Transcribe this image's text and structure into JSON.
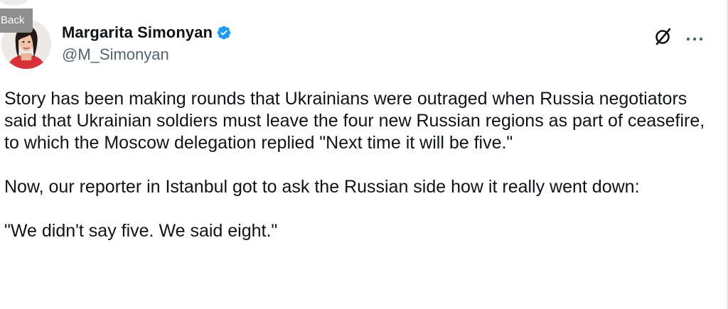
{
  "nav": {
    "back_label": "Back"
  },
  "author": {
    "display_name": "Margarita Simonyan",
    "handle": "@M_Simonyan",
    "verified": true,
    "verified_color": "#1d9bf0"
  },
  "actions": {
    "grok_icon": "grok-icon",
    "more_icon": "more-icon"
  },
  "tweet": {
    "paragraphs": [
      "Story has been making rounds that Ukrainians were outraged when Russia negotiators said that Ukrainian soldiers must leave the four new Russian regions as part of ceasefire, to which the Moscow delegation replied \"Next time it will be five.\"",
      "Now, our reporter in Istanbul got to ask the Russian side how it really went down:",
      "\"We didn't say five. We said eight.\""
    ]
  }
}
